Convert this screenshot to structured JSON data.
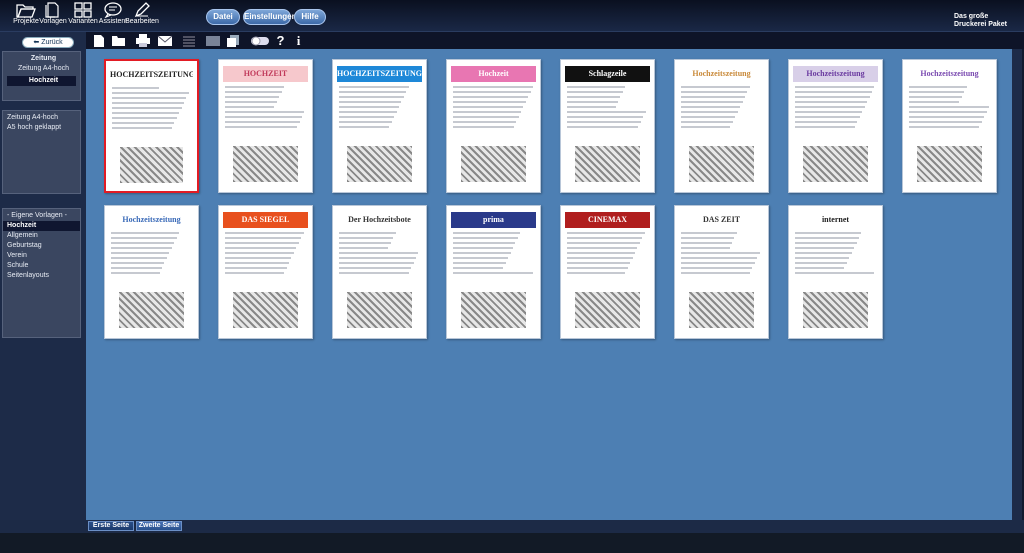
{
  "toolbar": {
    "projekte": "Projekte",
    "vorlagen": "Vorlagen",
    "varianten": "Varianten",
    "assistent": "Assistent",
    "bearbeiten": "Bearbeiten"
  },
  "menu": {
    "datei": "Datei",
    "einstellungen": "Einstellungen",
    "hilfe": "Hilfe"
  },
  "brand": {
    "line1": "Das große",
    "line2": "Druckerei Paket"
  },
  "sidebar": {
    "back": "Zurück",
    "types": [
      "Zeitung",
      "Zeitung A4-hoch",
      "Hochzeit"
    ],
    "formats": [
      "Zeitung A4-hoch",
      "A5 hoch geklappt"
    ],
    "categories": [
      "- Eigene Vorlagen -",
      "Hochzeit",
      "Allgemein",
      "Geburtstag",
      "Verein",
      "Schule",
      "Seitenlayouts"
    ]
  },
  "templates": [
    {
      "title": "HOCHZEITSZEITUNG",
      "accent": "#ffffff",
      "text": "#222222"
    },
    {
      "title": "HOCHZEIT",
      "accent": "#f6c8cc",
      "text": "#c0395a"
    },
    {
      "title": "HOCHZEITSZEITUNG",
      "accent": "#1e88d8",
      "text": "#ffffff"
    },
    {
      "title": "Hochzeit",
      "accent": "#e876b2",
      "text": "#ffffff"
    },
    {
      "title": "Schlagzeile",
      "accent": "#111111",
      "text": "#ffffff"
    },
    {
      "title": "Hochzeitszeitung",
      "accent": "#ffffff",
      "text": "#c98a3a"
    },
    {
      "title": "Hochzeitszeitung",
      "accent": "#d8cfe8",
      "text": "#6a3aa0"
    },
    {
      "title": "Hochzeitszeitung",
      "accent": "#ffffff",
      "text": "#7a4ab0"
    },
    {
      "title": "Hochzeitszeitung",
      "accent": "#ffffff",
      "text": "#3a6ab8"
    },
    {
      "title": "DAS SIEGEL",
      "accent": "#e8501e",
      "text": "#ffffff"
    },
    {
      "title": "Der Hochzeitsbote",
      "accent": "#ffffff",
      "text": "#333333"
    },
    {
      "title": "prima",
      "accent": "#2a3a8a",
      "text": "#ffffff"
    },
    {
      "title": "CINEMAX",
      "accent": "#b01e1e",
      "text": "#ffffff"
    },
    {
      "title": "DAS ZEIT",
      "accent": "#ffffff",
      "text": "#333333"
    },
    {
      "title": "internet",
      "accent": "#ffffff",
      "text": "#222222"
    }
  ],
  "bottom_tabs": [
    "Erste Seite",
    "Zweite Seite"
  ]
}
